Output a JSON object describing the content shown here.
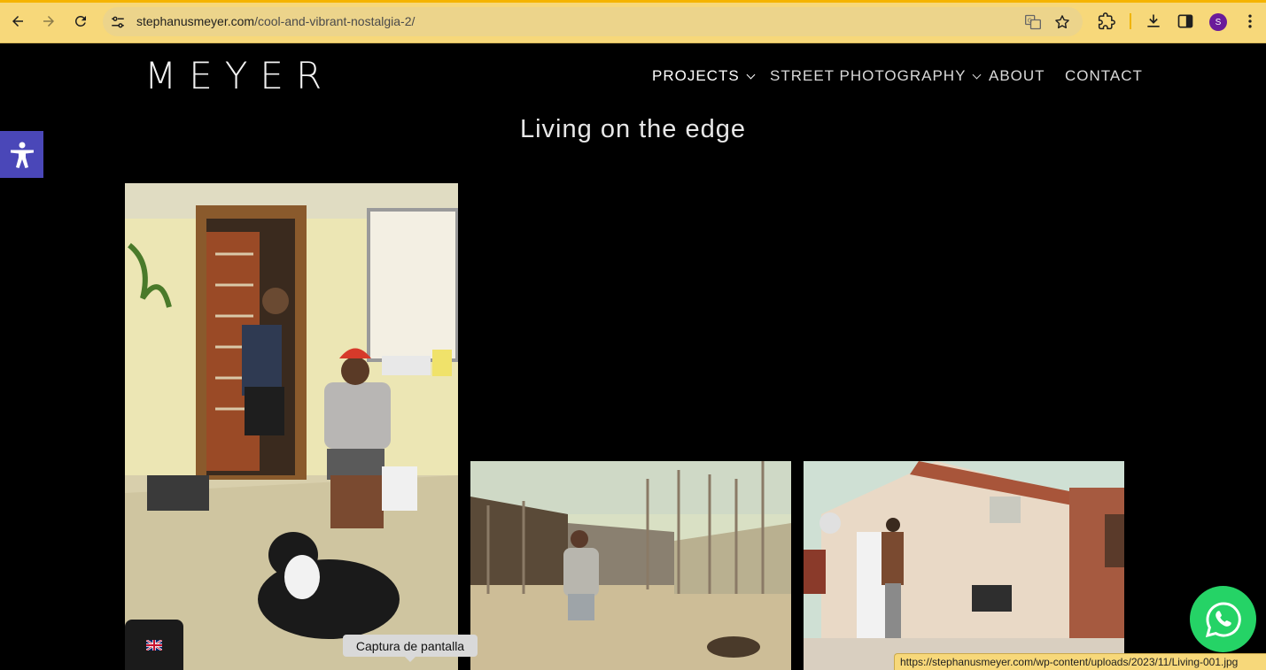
{
  "browser": {
    "url_host": "stephanusmeyer.com",
    "url_path": "/cool-and-vibrant-nostalgia-2/",
    "profile_initial": "S",
    "status_url": "https://stephanusmeyer.com/wp-content/uploads/2023/11/Living-001.jpg",
    "tooltip": "Captura de pantalla",
    "icons": [
      "back-icon",
      "forward-icon",
      "reload-icon",
      "tune-icon",
      "translate-icon",
      "bookmark-star-icon",
      "extensions-icon",
      "download-icon",
      "side-panel-icon",
      "kebab-menu-icon"
    ]
  },
  "site": {
    "logo": "MEYER",
    "nav": [
      {
        "label": "PROJECTS",
        "has_dropdown": true,
        "active": true
      },
      {
        "label": "STREET PHOTOGRAPHY",
        "has_dropdown": true,
        "active": false
      },
      {
        "label": "ABOUT",
        "has_dropdown": false,
        "active": false
      },
      {
        "label": "CONTACT",
        "has_dropdown": false,
        "active": false
      }
    ],
    "page_title": "Living on the edge"
  },
  "widgets": {
    "accessibility_icon": "accessibility-icon",
    "language_flag": "uk-flag-icon",
    "whatsapp_icon": "whatsapp-icon"
  },
  "colors": {
    "chrome_bg": "#f7d87a",
    "accessibility_bg": "#4a47b8",
    "whatsapp_bg": "#25d366"
  }
}
